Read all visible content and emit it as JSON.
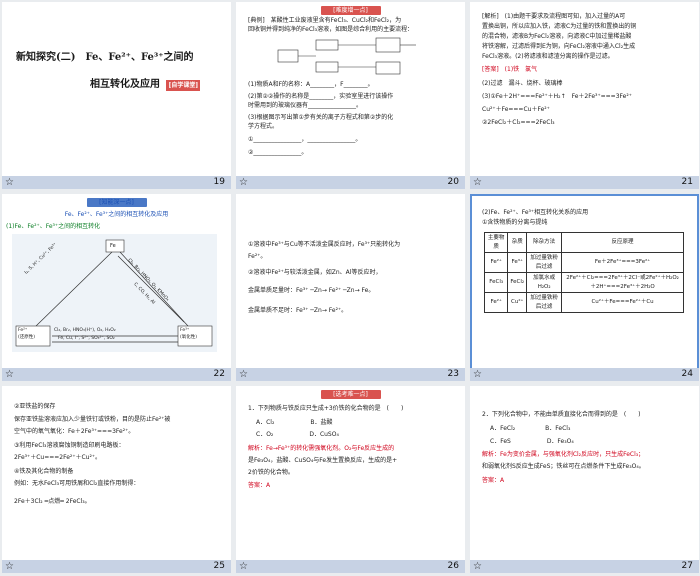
{
  "slides": [
    {
      "num": "19",
      "title_line1": "新知探究(二)　Fe、Fe²⁺、Fe³⁺之间的",
      "title_line2": "相互转化及应用",
      "tag": "[自学课堂]"
    },
    {
      "num": "20",
      "header": "[难度增一点]",
      "lines": [
        "[典例]　某酸性工业废液里含有FeCl₃、CuCl₂和FeCl₂，为",
        "回收铜并得到纯净的FeCl₃溶液，如图是综合利用的主要流程：",
        "(1)物质A和F的名称：A________，F________。",
        "(2)第②②操作的名称是________，实验室里进行该操作",
        "时需用到的玻璃仪器有________________。",
        "(3)根据图示写出第①步有关的离子方程式和第②步的化",
        "学方程式。",
        "①________________，________________。",
        "②________________。"
      ]
    },
    {
      "num": "21",
      "lines": [
        "[解析]　(1)由题干要求及流程图可知，加入过量的A可",
        "置换出铜，所以应加入铁，滤液C为过量的铁和置换出的铜",
        "的混合物，滤液B为FeCl₂溶液，向滤液C中加过量稀盐酸",
        "将铁溶解，过滤后得到E为铜，向FeCl₂溶液中通入Cl₂生成",
        "FeCl₃溶液。(2)将滤液和滤渣分离的操作是过滤。",
        "[答案]　(1)铁　氯气",
        "(2)过滤　漏斗、烧杯、玻璃棒",
        "(3)①Fe＋2H⁺===Fe²⁺＋H₂↑　Fe＋2Fe³⁺===3Fe²⁺",
        "Cu²⁺＋Fe===Cu＋Fe²⁺",
        "②2FeCl₂＋Cl₂===2FeCl₃"
      ]
    },
    {
      "num": "22",
      "header": "[知能深一点]",
      "lines": [
        "Fe、Fe²⁺、Fe³⁺之间的相互转化及应用",
        "(1)Fe、Fe²⁺、Fe³⁺之间的相互转化"
      ],
      "diagram": {
        "top": "Fe",
        "left": "Fe²⁺\n(还原性)",
        "right": "Fe³⁺\n(氧化性)",
        "bottom": "Fe, Cu, I⁻, S²⁻, SO₃²⁻, SO₂",
        "left_edge": "I₂, S, H⁺, Cu²⁺, Fe³⁺",
        "right_edge": "Cl₂, Br₂, HNO₃, O₂, KMnO₄",
        "middle": "C, CO, H₂, Al",
        "left_low": "Cl₂, Br₂, HNO₃(H⁺), O₂, H₂O₂"
      }
    },
    {
      "num": "23",
      "lines": [
        "①溶液中Fe³⁺与Cu等不活泼金属反应时，Fe³⁺只能转化为",
        "Fe²⁺。",
        "②溶液中Fe²⁺与较活泼金属，如Zn、Al等反应时，",
        "金属单质足量时：Fe³⁺ ─Zn→ Fe²⁺ ─Zn→ Fe。",
        "金属单质不足时：Fe³⁺ ─Zn→ Fe²⁺。"
      ]
    },
    {
      "num": "24",
      "lines": [
        "(2)Fe、Fe²⁺、Fe³⁺相互转化关系的应用",
        "①含铁物质的分离与提纯"
      ],
      "table": {
        "headers": [
          "主要物质",
          "杂质",
          "除杂方法",
          "反应原理"
        ],
        "rows": [
          [
            "Fe²⁺",
            "Fe³⁺",
            "加过量铁粉后过滤",
            "Fe＋2Fe³⁺===3Fe²⁺"
          ],
          [
            "FeCl₃",
            "FeCl₂",
            "加氯水或H₂O₂",
            "2Fe²⁺＋Cl₂===2Fe³⁺＋2Cl⁻或2Fe²⁺＋H₂O₂＋2H⁺===2Fe³⁺＋2H₂O"
          ],
          [
            "Fe²⁺",
            "Cu²⁺",
            "加过量铁粉后过滤",
            "Cu²⁺＋Fe===Fe²⁺＋Cu"
          ]
        ]
      }
    },
    {
      "num": "25",
      "lines": [
        "②亚铁盐的保存",
        "保存亚铁盐溶液应加入少量铁钉或铁粉，目的是防止Fe²⁺被",
        "空气中的氧气氧化：Fe＋2Fe³⁺===3Fe²⁺。",
        "③利用FeCl₃溶液腐蚀铜制造印刷电路板：",
        "2Fe³⁺＋Cu===2Fe²⁺＋Cu²⁺。",
        "④铁及其化合物的制备",
        "例如：无水FeCl₃可用铁屑和Cl₂直接作用制得：",
        "2Fe＋3Cl₂ ═点燃═ 2FeCl₃。"
      ]
    },
    {
      "num": "26",
      "header": "[选考难一点]",
      "lines": [
        "1．下列物质与铁反应只生成+3价铁的化合物的是　(　　)",
        "A．Cl₂　　　　　　B．盐酸",
        "C．O₂　　　　　　D．CuSO₄",
        "解析：Fe→Fe³⁺的转化需强氧化剂。O₂与Fe反应生成的",
        "是Fe₃O₄，盐酸、CuSO₄与Fe发生置换反应，生成的是+",
        "2价铁的化合物。",
        "答案：A"
      ]
    },
    {
      "num": "27",
      "lines": [
        "2．下列化合物中，不能由单质直接化合而得到的是　(　　)",
        "A．FeCl₂　　　　　B．FeCl₃",
        "C．FeS　　　　　　D．Fe₃O₄",
        "解析：Fe为变价金属，与强氧化剂Cl₂反应时，只生成FeCl₃；",
        "和弱氧化剂S反应生成FeS；铁丝可在点燃条件下生成Fe₃O₄。",
        "答案：A"
      ]
    }
  ],
  "icons": {
    "star": "☆"
  }
}
